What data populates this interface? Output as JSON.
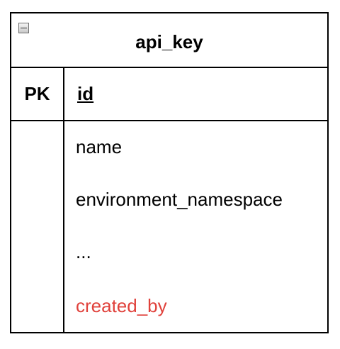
{
  "entity": {
    "name": "api_key",
    "primary_key": {
      "label": "PK",
      "field": "id"
    },
    "fields": [
      {
        "name": "name"
      },
      {
        "name": "environment_namespace"
      },
      {
        "name": "..."
      },
      {
        "name": "created_by",
        "color": "#e0413b"
      }
    ]
  },
  "icons": {
    "collapse": "minus-square-icon"
  }
}
